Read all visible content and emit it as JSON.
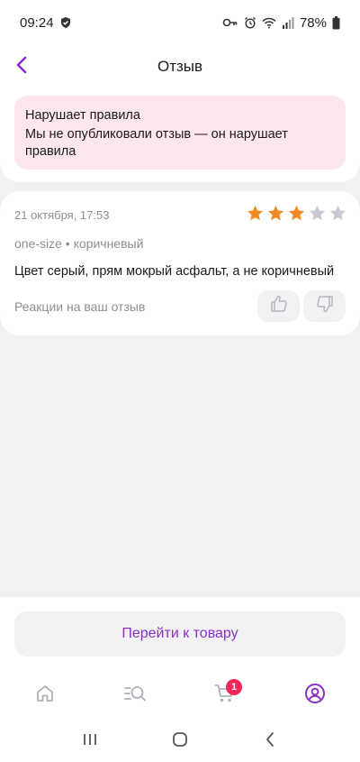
{
  "status_bar": {
    "time": "09:24",
    "battery": "78%"
  },
  "header": {
    "title": "Отзыв",
    "back_icon": "chevron-left-icon"
  },
  "warning": {
    "title": "Нарушает правила",
    "text": "Мы не опубликовали отзыв — он нарушает правила"
  },
  "review": {
    "date": "21 октября, 17:53",
    "rating": 3,
    "rating_max": 5,
    "variant": "one-size • коричневый",
    "text": "Цвет серый, прям мокрый асфальт, а не коричневый",
    "reactions_label": "Реакции на ваш отзыв"
  },
  "actions": {
    "go_to_product": "Перейти к товару"
  },
  "tabbar": {
    "items": [
      {
        "icon": "home-icon"
      },
      {
        "icon": "catalog-search-icon"
      },
      {
        "icon": "cart-icon",
        "badge": "1"
      },
      {
        "icon": "profile-icon",
        "active": true
      }
    ]
  },
  "colors": {
    "accent": "#8b2fc9",
    "warning_bg": "#fde6ec",
    "star_filled": "#f08a24",
    "star_empty": "#c9c9d2",
    "badge": "#f0285a"
  }
}
